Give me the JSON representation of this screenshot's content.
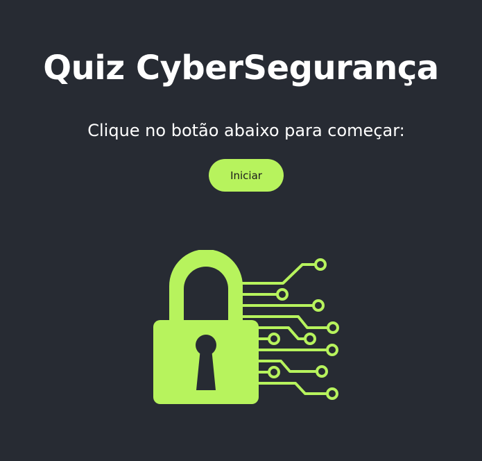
{
  "header": {
    "title": "Quiz CyberSegurança"
  },
  "intro": {
    "instruction": "Clique no botão abaixo para começar:",
    "start_button_label": "Iniciar"
  },
  "theme": {
    "background": "#272b33",
    "accent": "#b7f35d",
    "text": "#ffffff"
  },
  "illustration": {
    "icon": "circuit-padlock-icon"
  }
}
